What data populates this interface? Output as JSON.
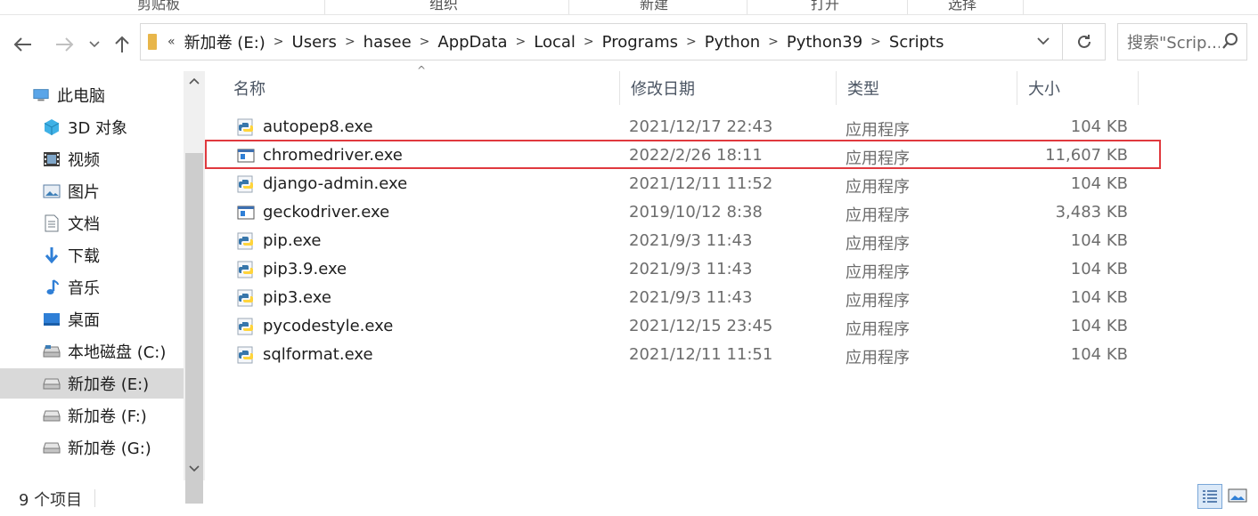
{
  "ribbon": {
    "groups": [
      "剪贴板",
      "组织",
      "新建",
      "打开",
      "选择"
    ]
  },
  "nav": {
    "back_icon": "back-arrow-icon",
    "forward_icon": "forward-arrow-icon",
    "recent_icon": "chevron-down-icon",
    "up_icon": "up-arrow-icon"
  },
  "address": {
    "overflow": "«",
    "segments": [
      "新加卷 (E:)",
      "Users",
      "hasee",
      "AppData",
      "Local",
      "Programs",
      "Python",
      "Python39",
      "Scripts"
    ]
  },
  "search": {
    "placeholder": "搜索\"Scrip..."
  },
  "sidebar": {
    "items": [
      {
        "label": "此电脑",
        "icon": "computer-icon"
      },
      {
        "label": "3D 对象",
        "icon": "3d-objects-icon"
      },
      {
        "label": "视频",
        "icon": "video-icon"
      },
      {
        "label": "图片",
        "icon": "pictures-icon"
      },
      {
        "label": "文档",
        "icon": "documents-icon"
      },
      {
        "label": "下载",
        "icon": "download-icon"
      },
      {
        "label": "音乐",
        "icon": "music-icon"
      },
      {
        "label": "桌面",
        "icon": "desktop-icon"
      },
      {
        "label": "本地磁盘 (C:)",
        "icon": "drive-icon"
      },
      {
        "label": "新加卷 (E:)",
        "icon": "drive-icon",
        "selected": true
      },
      {
        "label": "新加卷 (F:)",
        "icon": "drive-icon"
      },
      {
        "label": "新加卷 (G:)",
        "icon": "drive-icon"
      }
    ]
  },
  "columns": {
    "name": "名称",
    "date": "修改日期",
    "type": "类型",
    "size": "大小"
  },
  "files": [
    {
      "name": "autopep8.exe",
      "date": "2021/12/17 22:43",
      "type": "应用程序",
      "size": "104 KB",
      "icon": "python-exe-icon"
    },
    {
      "name": "chromedriver.exe",
      "date": "2022/2/26 18:11",
      "type": "应用程序",
      "size": "11,607 KB",
      "icon": "exe-window-icon",
      "highlighted": true
    },
    {
      "name": "django-admin.exe",
      "date": "2021/12/11 11:52",
      "type": "应用程序",
      "size": "104 KB",
      "icon": "python-exe-icon"
    },
    {
      "name": "geckodriver.exe",
      "date": "2019/10/12 8:38",
      "type": "应用程序",
      "size": "3,483 KB",
      "icon": "exe-window-icon"
    },
    {
      "name": "pip.exe",
      "date": "2021/9/3 11:43",
      "type": "应用程序",
      "size": "104 KB",
      "icon": "python-exe-icon"
    },
    {
      "name": "pip3.9.exe",
      "date": "2021/9/3 11:43",
      "type": "应用程序",
      "size": "104 KB",
      "icon": "python-exe-icon"
    },
    {
      "name": "pip3.exe",
      "date": "2021/9/3 11:43",
      "type": "应用程序",
      "size": "104 KB",
      "icon": "python-exe-icon"
    },
    {
      "name": "pycodestyle.exe",
      "date": "2021/12/15 23:45",
      "type": "应用程序",
      "size": "104 KB",
      "icon": "python-exe-icon"
    },
    {
      "name": "sqlformat.exe",
      "date": "2021/12/11 11:51",
      "type": "应用程序",
      "size": "104 KB",
      "icon": "python-exe-icon"
    }
  ],
  "status": {
    "count": "9 个项目"
  },
  "colors": {
    "highlight": "#e0393e",
    "selected_bg": "#d9d9d9",
    "folder": "#e8b64a"
  }
}
